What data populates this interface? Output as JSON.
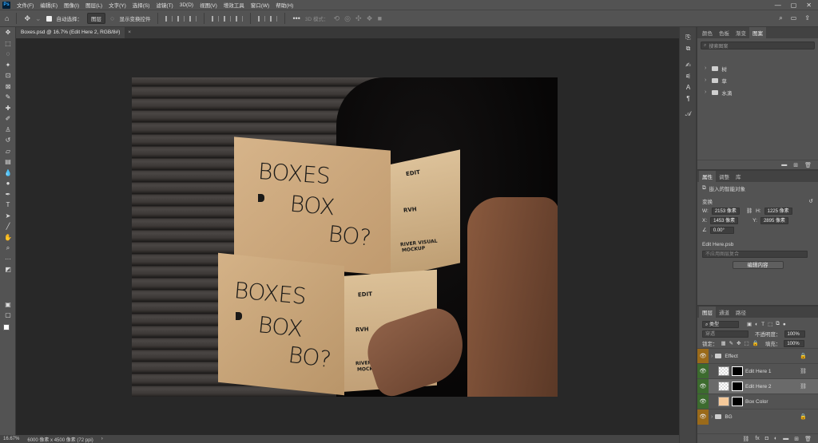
{
  "app": {
    "logo": "Ps"
  },
  "menu": [
    "文件(F)",
    "编辑(E)",
    "图像(I)",
    "图层(L)",
    "文字(Y)",
    "选择(S)",
    "滤镜(T)",
    "3D(D)",
    "视图(V)",
    "增效工具",
    "窗口(W)",
    "帮助(H)"
  ],
  "window_controls": {
    "minimize": "—",
    "maximize": "▢",
    "close": "✕"
  },
  "options": {
    "auto_select_label": "自动选择：",
    "auto_select_value": "图层",
    "show_transform_label": "显示变换控件",
    "mode_3d_label": "3D 模式："
  },
  "document_tab": {
    "title": "Boxes.psd @ 16.7% (Edit Here 2, RGB/8#)",
    "close": "×"
  },
  "canvas_text": {
    "top_boxes": "BOXES",
    "top_box": "BOX",
    "top_bo": "BO?",
    "top_edit": "EDIT",
    "top_rvh": "RVH",
    "top_river": "RIVER VISUAL",
    "top_mockup": "MOCKUP",
    "bot_boxes": "BOXES",
    "bot_box": "BOX",
    "bot_bo": "BO?",
    "bot_edit": "EDIT",
    "bot_rvh": "RVH",
    "bot_river": "RIVER VISUAL",
    "bot_mockup": "MOCKUP"
  },
  "status": {
    "zoom": "16.67%",
    "doc_info": "6000 像素 x 4500 像素 (72 ppi)",
    "arrow": "›"
  },
  "swatches_panel": {
    "tabs": [
      "颜色",
      "色板",
      "渐变",
      "图案"
    ],
    "active_tab": "图案",
    "search_placeholder": "搜索图案",
    "folders": [
      "树",
      "草",
      "水滴"
    ]
  },
  "properties_panel": {
    "tabs": [
      "属性",
      "调整",
      "库"
    ],
    "active_tab": "属性",
    "object_type": "嵌入的智能对象",
    "section": "变换",
    "w_label": "W:",
    "w_value": "2153 像素",
    "h_label": "H:",
    "h_value": "1225 像素",
    "x_label": "X:",
    "x_value": "1453 像素",
    "y_label": "Y:",
    "y_value": "2895 像素",
    "angle_value": "0.00°",
    "file_name": "Edit Here.psb",
    "comp_placeholder": "不应用图层复合",
    "edit_button": "编辑内容"
  },
  "layers_panel": {
    "tabs": [
      "图层",
      "通道",
      "路径"
    ],
    "active_tab": "图层",
    "filter_label": "类型",
    "blend_mode": "穿透",
    "opacity_label": "不透明度：",
    "opacity_value": "100%",
    "lock_label": "锁定：",
    "fill_label": "填充：",
    "fill_value": "100%",
    "layers": [
      {
        "name": "Effect",
        "type": "group",
        "color": "#9a6a1a"
      },
      {
        "name": "Edit Here 1",
        "type": "smart",
        "color": "#3c6b2e"
      },
      {
        "name": "Edit Here 2",
        "type": "smart",
        "color": "#3c6b2e"
      },
      {
        "name": "Box Color",
        "type": "fill",
        "color": "#3c6b2e",
        "swatch": "#f5c99a"
      },
      {
        "name": "BG",
        "type": "group",
        "color": "#9a6a1a"
      }
    ]
  }
}
